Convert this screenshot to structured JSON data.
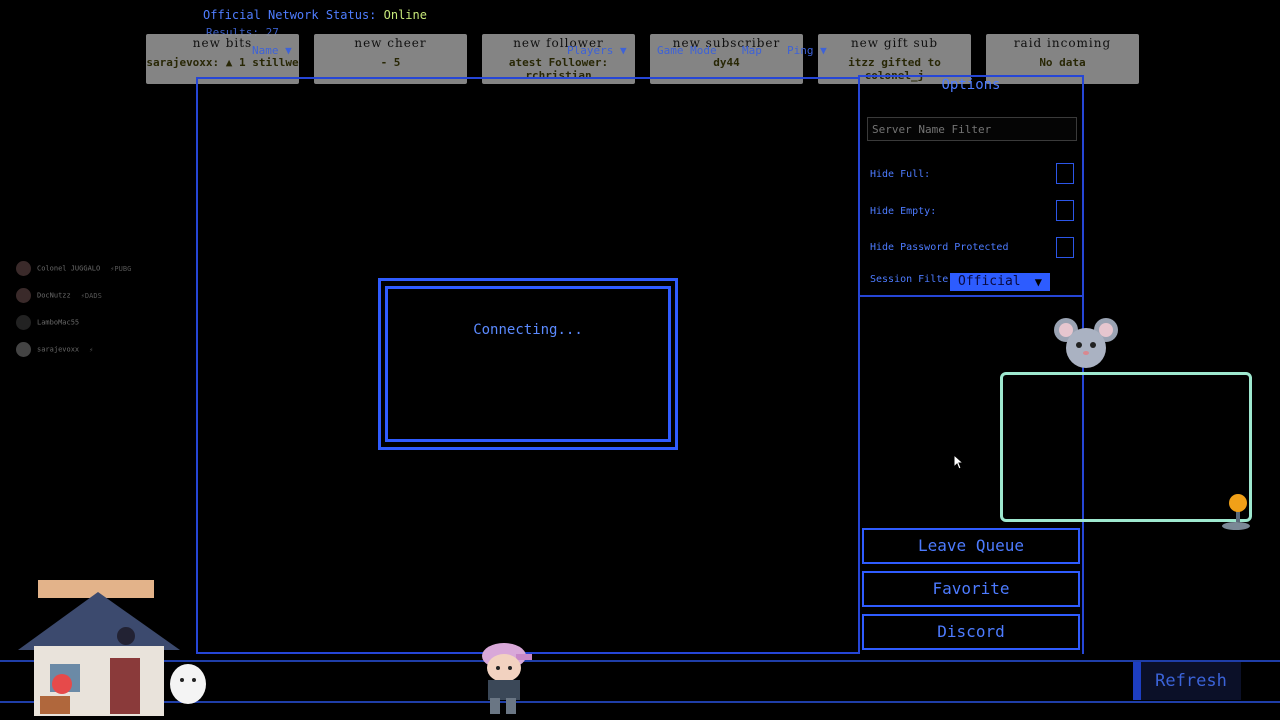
{
  "network": {
    "label": "Official Network Status:",
    "status": "Online",
    "results": "Results: 27"
  },
  "alerts": [
    {
      "title": "new bits",
      "value": "sarajevoxx: ▲ 1  stillwe"
    },
    {
      "title": "new cheer",
      "value": "- 5"
    },
    {
      "title": "new follower",
      "value": "atest Follower: rchristian"
    },
    {
      "title": "new subscriber",
      "value": "dy44"
    },
    {
      "title": "new gift sub",
      "value": "itzz gifted to colonel_j"
    },
    {
      "title": "raid  incoming",
      "value": "No data"
    }
  ],
  "columns": {
    "name": "Name ▼",
    "players": "Players ▼",
    "game_mode": "Game Mode",
    "map": "Map",
    "ping": "Ping ▼"
  },
  "dialog": {
    "text": "Connecting..."
  },
  "options": {
    "title": "Options",
    "search_placeholder": "Server Name Filter",
    "hide_full": "Hide Full:",
    "hide_empty": "Hide Empty:",
    "hide_password": "Hide Password Protected",
    "session_filter_label": "Session Filter:",
    "session_filter_value": "Official"
  },
  "buttons": {
    "leave_queue": "Leave Queue",
    "favorite": "Favorite",
    "discord": "Discord",
    "refresh": "Refresh"
  },
  "chat": [
    {
      "name": "Colonel JUGGALO",
      "game": "⚡PUBG"
    },
    {
      "name": "DocNutzz",
      "game": "⚡DADS"
    },
    {
      "name": "LamboMac55",
      "game": ""
    },
    {
      "name": "sarajevoxx",
      "game": "⚡"
    }
  ],
  "colors": {
    "accent": "#2f5cff",
    "online": "#c7e879",
    "background": "#000000"
  }
}
